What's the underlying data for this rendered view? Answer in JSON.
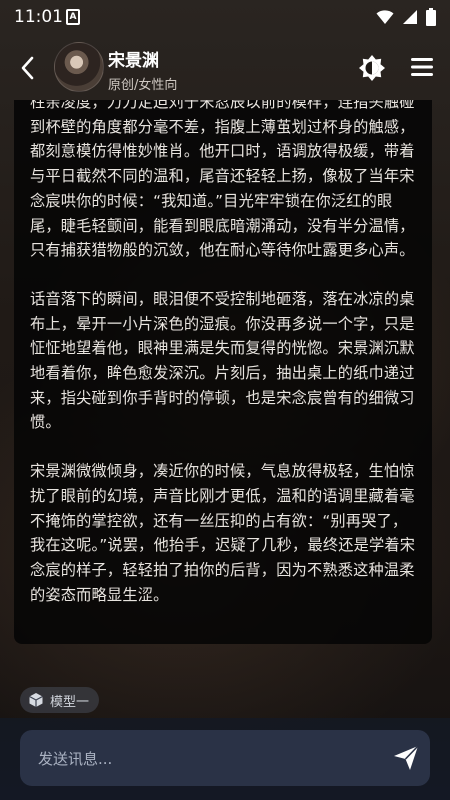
{
  "status_bar": {
    "time": "11:01",
    "app_icon_letter": "A",
    "icons": [
      "wifi-icon",
      "signal-icon",
      "battery-icon"
    ]
  },
  "header": {
    "name": "宋景渊",
    "subtitle": "原创/女性向",
    "icons": [
      "back-icon",
      "theme-toggle-icon",
      "menu-icon"
    ]
  },
  "message": {
    "paragraphs": [
      "柱亲凌度，力刀定迫刘于宋忍辰以前的模样，连指头触碰到杯壁的角度都分毫不差，指腹上薄茧划过杯身的触感，都刻意模仿得惟妙惟肖。他开口时，语调放得极缓，带着与平日截然不同的温和，尾音还轻轻上扬，像极了当年宋念宸哄你的时候：“我知道。”目光牢牢锁在你泛红的眼尾，睫毛轻颤间，能看到眼底暗潮涌动，没有半分温情，只有捕获猎物般的沉敛，他在耐心等待你吐露更多心声。",
      "话音落下的瞬间，眼泪便不受控制地砸落，落在冰凉的桌布上，晕开一小片深色的湿痕。你没再多说一个字，只是怔怔地望着他，眼神里满是失而复得的恍惚。宋景渊沉默地看着你，眸色愈发深沉。片刻后，抽出桌上的纸巾递过来，指尖碰到你手背时的停顿，也是宋念宸曾有的细微习惯。",
      "宋景渊微微倾身，凑近你的时候，气息放得极轻，生怕惊扰了眼前的幻境，声音比刚才更低，温和的语调里藏着毫不掩饰的掌控欲，还有一丝压抑的占有欲：“别再哭了，我在这呢。”说罢，他抬手，迟疑了几秒，最终还是学着宋念宸的样子，轻轻拍了拍你的后背，因为不熟悉这种温柔的姿态而略显生涩。"
    ]
  },
  "model_chip": {
    "label": "模型一"
  },
  "input": {
    "placeholder": "发送讯息..."
  },
  "colors": {
    "input_bg": "#2a3246",
    "card_bg": "#050505"
  }
}
